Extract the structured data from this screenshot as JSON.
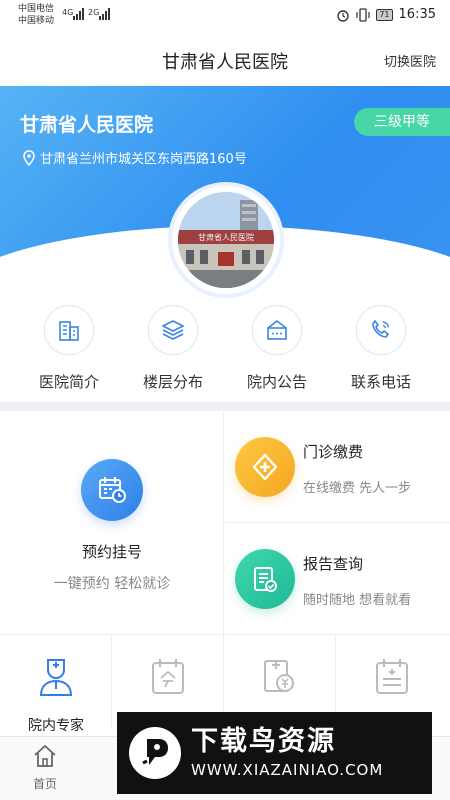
{
  "status_bar": {
    "carrier_1": "中国电信",
    "carrier_2": "中国移动",
    "network_1": "4G",
    "network_2": "2G",
    "battery": "71",
    "time": "16:35"
  },
  "navbar": {
    "title": "甘肃省人民医院",
    "switch_label": "切换医院"
  },
  "banner": {
    "hospital_name": "甘肃省人民医院",
    "address": "甘肃省兰州市城关区东岗西路160号",
    "level": "三级甲等",
    "photo_sign": "甘肃省人民医院"
  },
  "quick_menu": [
    {
      "label": "医院简介",
      "icon": "building-icon"
    },
    {
      "label": "楼层分布",
      "icon": "layers-icon"
    },
    {
      "label": "院内公告",
      "icon": "notice-icon"
    },
    {
      "label": "联系电话",
      "icon": "phone-icon"
    }
  ],
  "services": {
    "booking": {
      "title": "预约挂号",
      "subtitle": "一键预约 轻松就诊",
      "icon": "calendar-clock-icon"
    },
    "payment": {
      "title": "门诊缴费",
      "subtitle": "在线缴费 先人一步",
      "icon": "plus-icon"
    },
    "report": {
      "title": "报告查询",
      "subtitle": "随时随地 想看就看",
      "icon": "report-icon"
    },
    "row3": [
      {
        "label": "院内专家",
        "icon": "doctor-icon"
      },
      {
        "label": "",
        "icon": "today-calendar-icon"
      },
      {
        "label": "",
        "icon": "yuan-document-icon"
      },
      {
        "label": "",
        "icon": "medical-calendar-icon"
      }
    ]
  },
  "tabbar": {
    "items": [
      {
        "label": "首页",
        "icon": "home-icon"
      },
      {
        "label": "",
        "icon": "tab-icon"
      },
      {
        "label": "",
        "icon": "tab-icon"
      },
      {
        "label": "",
        "icon": "tab-icon"
      },
      {
        "label": "",
        "icon": "tab-icon"
      }
    ]
  },
  "watermark": {
    "title": "下载鸟资源",
    "url": "WWW.XIAZAINIAO.COM"
  },
  "colors": {
    "banner_blue": "#2f8ef0",
    "badge_green": "#46d6a8",
    "payment_yellow": "#f7b928",
    "report_green": "#2ec9a0",
    "icon_blue": "#2f7fe8"
  }
}
